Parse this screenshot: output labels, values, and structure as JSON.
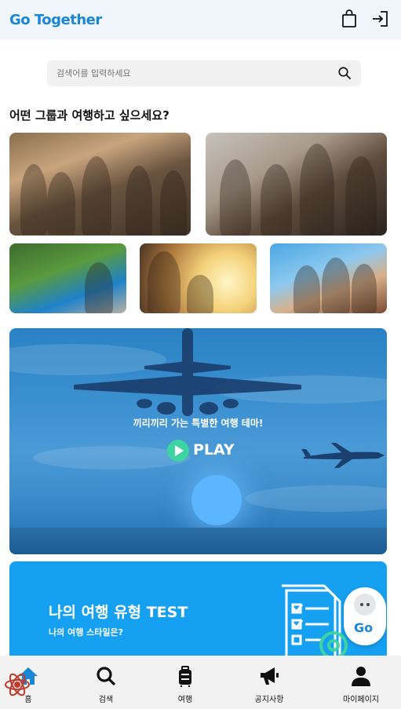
{
  "header": {
    "logo_prefix": "Go",
    "logo_suffix": " Together",
    "icons": [
      "shopping-bag-icon",
      "login-icon"
    ]
  },
  "search": {
    "placeholder": "검색어를 입력하세요",
    "icon": "search-icon"
  },
  "section_title": "어떤 그룹과 여행하고 싶으세요?",
  "group_tiles": [
    {
      "name": "seniors-group"
    },
    {
      "name": "friends-group"
    },
    {
      "name": "train-trip"
    },
    {
      "name": "couple-sunset"
    },
    {
      "name": "youth-friends"
    }
  ],
  "play_banner": {
    "tagline": "끼리끼리 가는 특별한 여행 테마!",
    "play_label": "PLAY"
  },
  "test_banner": {
    "title": "나의 여행 유형 TEST",
    "subtitle": "나의 여행 스타일은?"
  },
  "floating_button": {
    "label": "Go"
  },
  "bottom_nav": {
    "items": [
      {
        "label": "홈",
        "icon": "home-icon"
      },
      {
        "label": "검색",
        "icon": "search-icon"
      },
      {
        "label": "여행",
        "icon": "luggage-icon"
      },
      {
        "label": "공지사항",
        "icon": "megaphone-icon"
      },
      {
        "label": "마이페이지",
        "icon": "user-icon"
      }
    ]
  },
  "colors": {
    "brand_blue": "#1a86d8",
    "brand_green": "#3fc0a0",
    "header_bg": "#f1f6fc",
    "test_banner_bg": "#16a0f2",
    "play_green": "#3ed3a2"
  }
}
